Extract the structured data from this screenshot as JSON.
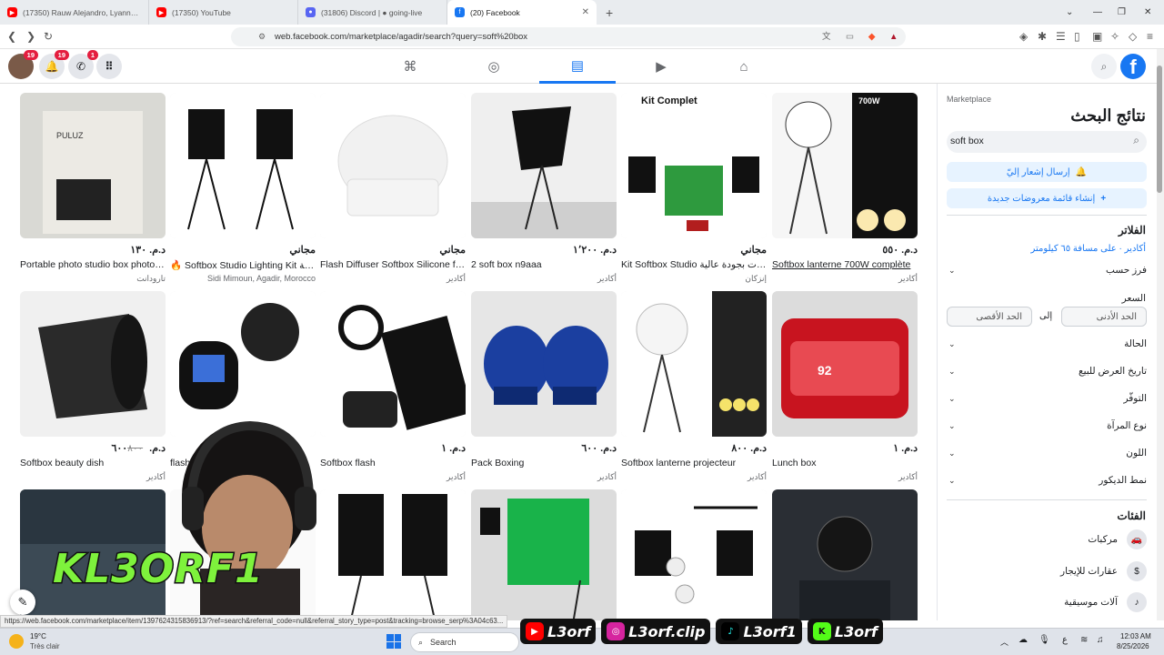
{
  "browser": {
    "tabs": [
      {
        "title": "(17350) Rauw Alejandro, Lyanno, Bra",
        "icon": "youtube-icon",
        "color": "#ff0000"
      },
      {
        "title": "(17350) YouTube",
        "icon": "youtube-icon",
        "color": "#ff0000"
      },
      {
        "title": "(31806) Discord | ● going-live",
        "icon": "discord-icon",
        "color": "#5865f2"
      },
      {
        "title": "(20) Facebook",
        "icon": "facebook-icon",
        "color": "#1877f2",
        "active": true
      }
    ],
    "url": "web.facebook.com/marketplace/agadir/search?query=soft%20box"
  },
  "fbnav": {
    "notif_badge": "19",
    "messenger_badge": "1"
  },
  "listings": [
    {
      "price": "د.م. ١٣٠",
      "title": "Portable photo studio box photog...",
      "loc": "تارودانت",
      "img": "lightbox"
    },
    {
      "price": "مجاني",
      "title": "🔥 Softbox Studio Lighting Kit عالية...",
      "loc": "Sidi Mimoun, Agadir, Morocco",
      "img": "softbox2"
    },
    {
      "price": "مجاني",
      "title": "Flash Diffuser Softbox Silicone for ...",
      "loc": "أكادير",
      "img": "diffuser"
    },
    {
      "price": "د.م. ١٬٢٠٠",
      "title": "2 soft box n9aaa",
      "loc": "أكادير",
      "img": "softbox1"
    },
    {
      "price": "مجاني",
      "title": "Kit Softbox Studio هات بجودة عالية...",
      "loc": "إنزكان",
      "img": "kit"
    },
    {
      "price": "د.م. ٥٥٠",
      "title": "Softbox lanterne 700W complète",
      "loc": "أكادير",
      "img": "lantern"
    },
    {
      "price": "د.م. ٦٠٠",
      "old": "٨٠٠",
      "title": "Softbox beauty dish",
      "loc": "أكادير",
      "img": "dish"
    },
    {
      "price": "",
      "title": "flash",
      "loc": "",
      "img": "flash"
    },
    {
      "price": "د.م. ١",
      "title": "Softbox flash",
      "loc": "أكادير",
      "img": "godox"
    },
    {
      "price": "د.م. ٦٠٠",
      "title": "Pack Boxing",
      "loc": "أكادير",
      "img": "gloves"
    },
    {
      "price": "د.م. ٨٠٠",
      "title": "Softbox lanterne projecteur",
      "loc": "أكادير",
      "img": "lantern2"
    },
    {
      "price": "د.م. ١",
      "title": "Lunch box",
      "loc": "أكادير",
      "img": "lunch"
    },
    {
      "price": "",
      "title": "",
      "loc": "",
      "img": "dark"
    },
    {
      "price": "",
      "title": "",
      "loc": "",
      "img": "blank"
    },
    {
      "price": "",
      "title": "",
      "loc": "",
      "img": "panel"
    },
    {
      "price": "",
      "title": "",
      "loc": "",
      "img": "green"
    },
    {
      "price": "",
      "title": "",
      "loc": "",
      "img": "kit3"
    },
    {
      "price": "",
      "title": "",
      "loc": "",
      "img": "bag"
    }
  ],
  "sidebar": {
    "breadcrumb": "Marketplace",
    "title": "نتائج البحث",
    "search_value": "soft box",
    "notify_btn": "إرسال إشعار إليّ",
    "create_btn": "إنشاء قائمة معروضات جديدة",
    "filters_title": "الفلاتر",
    "location": "أكادير · على مسافة ٦٥ كيلومتر",
    "sort_by": "فرز حسب",
    "price": "السعر",
    "min_placeholder": "الحد الأدنى",
    "to": "إلى",
    "max_placeholder": "الحد الأقصى",
    "filters": [
      "الحالة",
      "تاريخ العرض للبيع",
      "التوفّر",
      "نوع المرآة",
      "اللون",
      "نمط الديكور"
    ],
    "categories_title": "الفئات",
    "categories": [
      {
        "label": "مركبات",
        "icon": "car-icon"
      },
      {
        "label": "عقارات للإيجار",
        "icon": "house-dollar-icon"
      },
      {
        "label": "آلات موسيقية",
        "icon": "guitar-icon"
      }
    ]
  },
  "status_url": "https://web.facebook.com/marketplace/item/1397624315836913/?ref=search&referral_code=null&referral_story_type=post&tracking=browse_serp%3A04c63...",
  "taskbar": {
    "temp": "19°C",
    "weather": "Très clair",
    "search": "Search",
    "time": "12:03 AM",
    "date": "8/25/2026"
  },
  "stream": {
    "brand": "KL3ORF1",
    "socials": [
      {
        "icon": "youtube-icon",
        "label": "L3orf",
        "color": "#ff0000"
      },
      {
        "icon": "instagram-icon",
        "label": "L3orf.clip",
        "color": "#d6249f"
      },
      {
        "icon": "tiktok-icon",
        "label": "L3orf1",
        "color": "#000000"
      },
      {
        "icon": "kick-icon",
        "label": "L3orf",
        "color": "#53fc18"
      }
    ]
  }
}
